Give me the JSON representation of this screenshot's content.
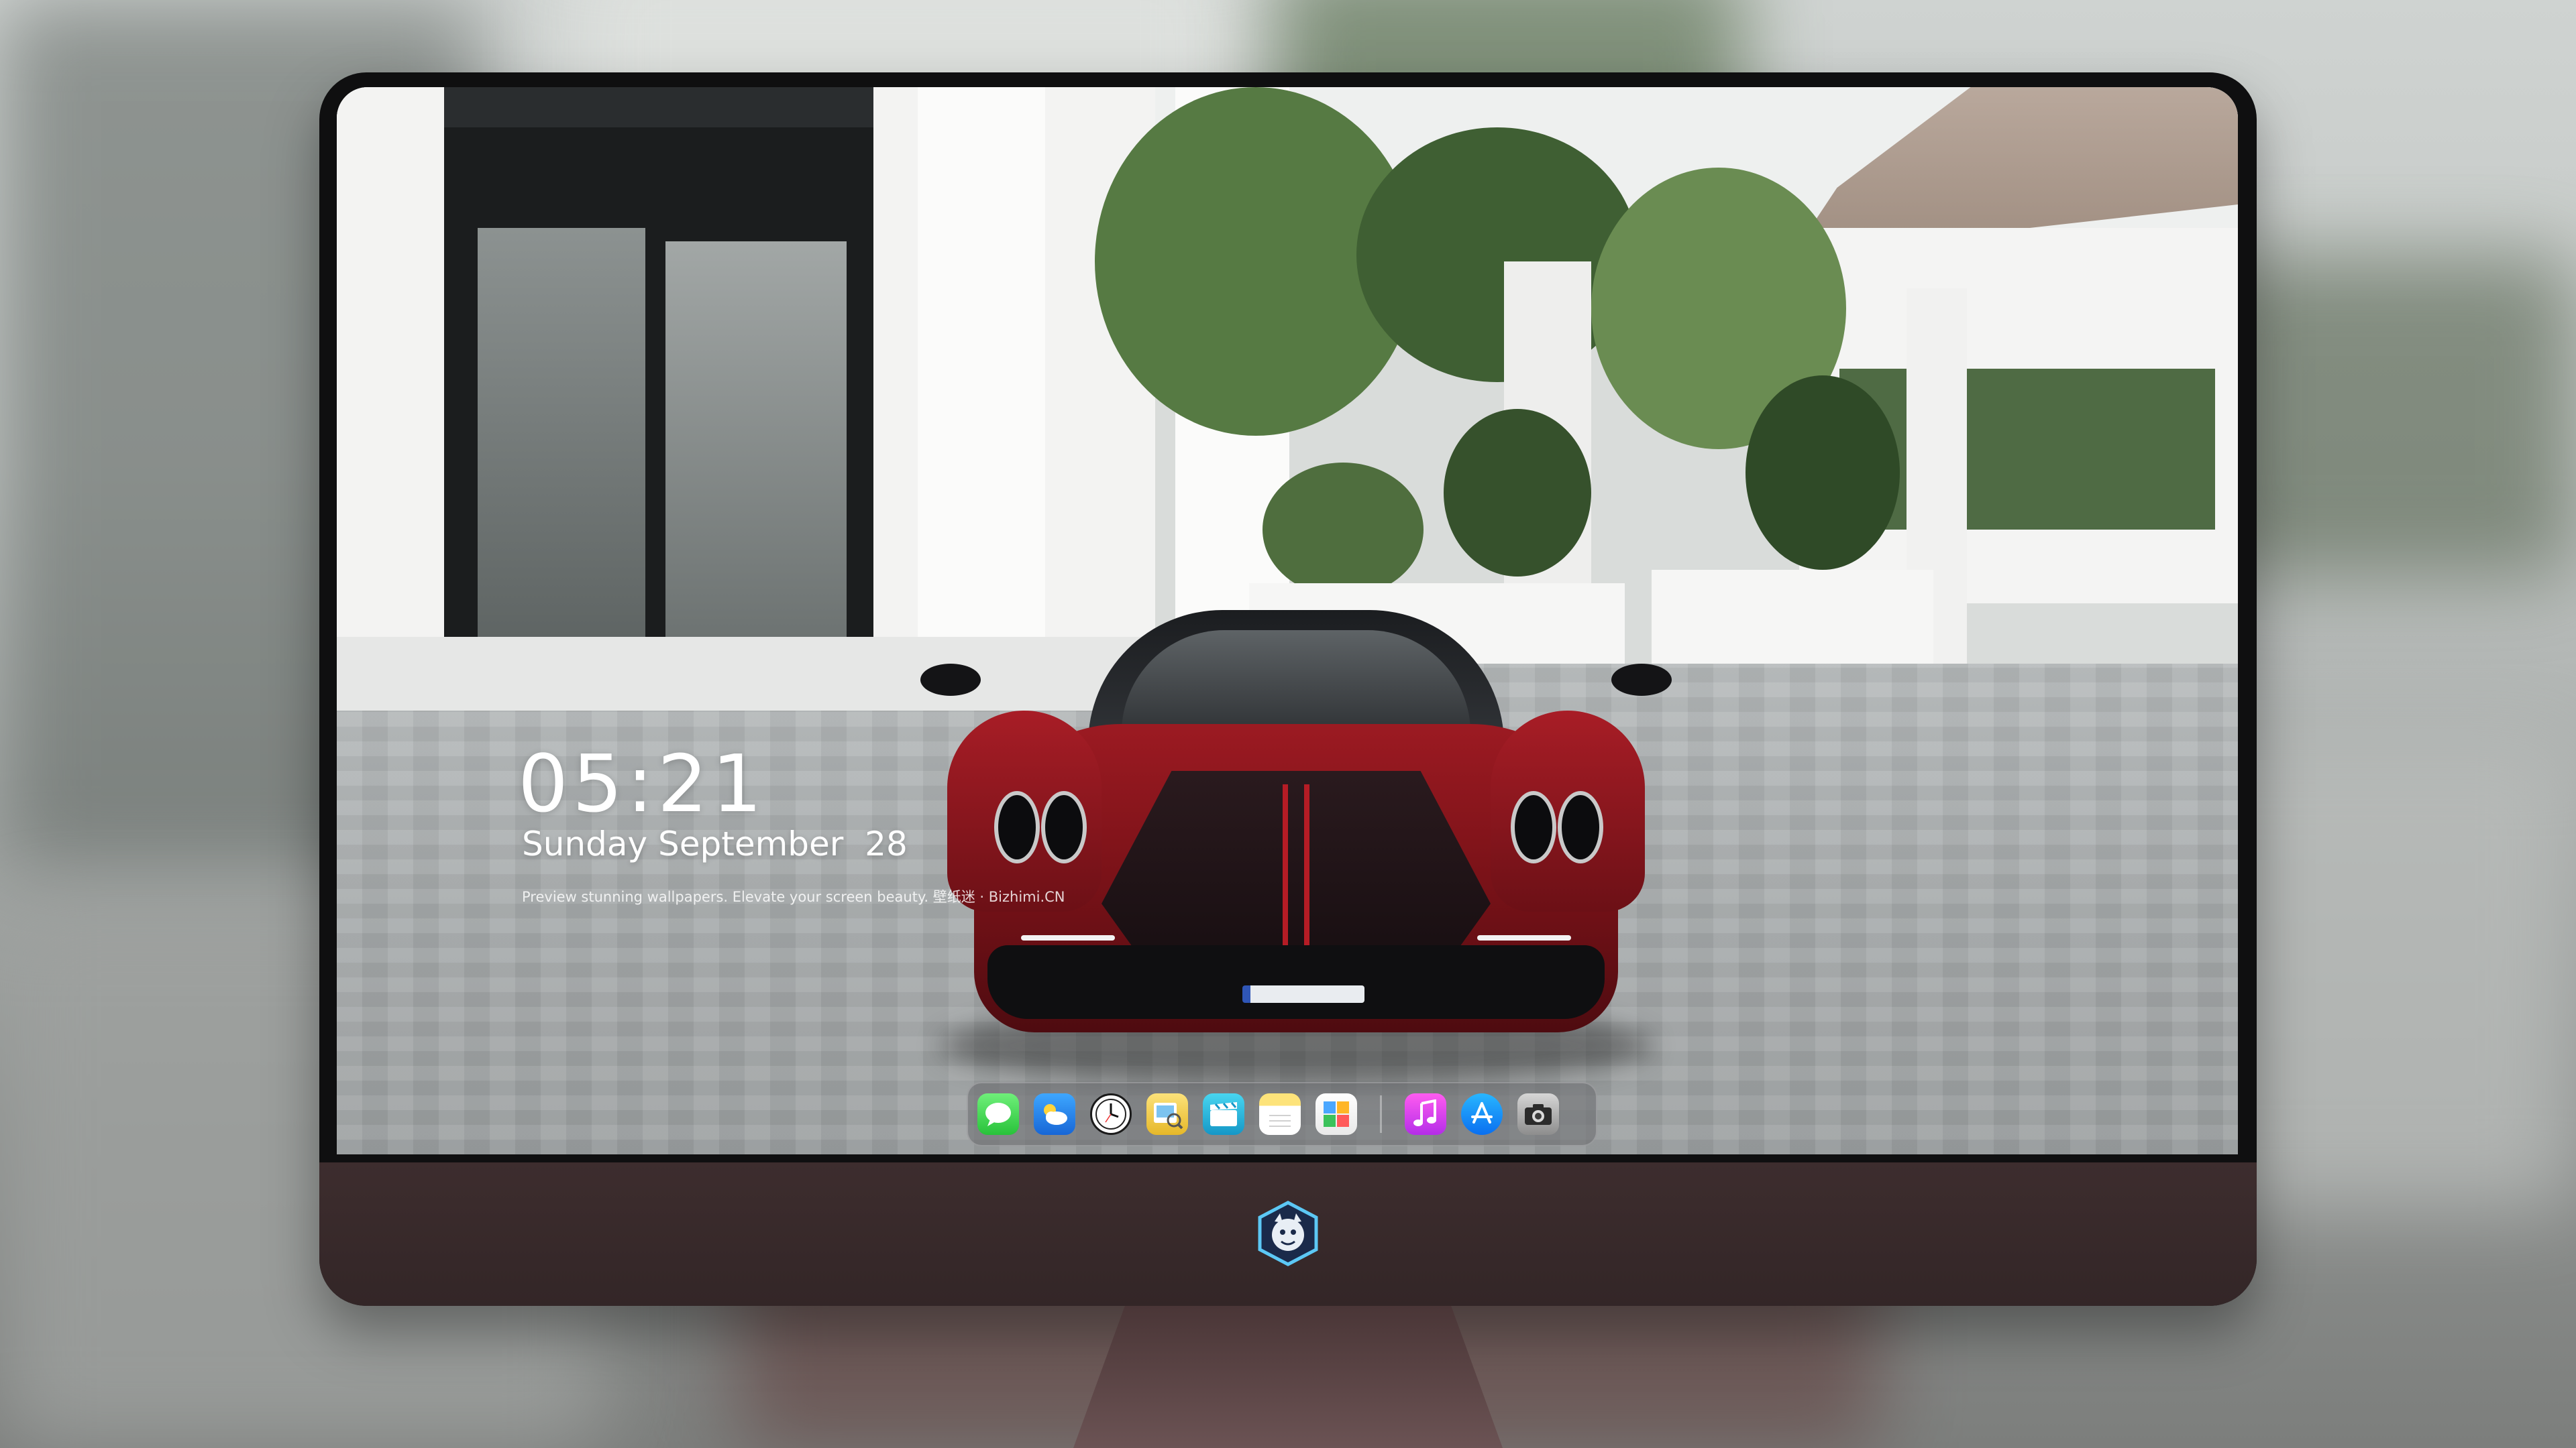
{
  "lock_screen": {
    "time": "05:21",
    "date": "Sunday September  28",
    "tagline": "Preview stunning wallpapers. Elevate your screen beauty. 壁纸迷 · Bizhimi.CN"
  },
  "dock": {
    "apps": [
      {
        "name": "Messages",
        "icon": "messages-icon"
      },
      {
        "name": "Weather",
        "icon": "weather-icon"
      },
      {
        "name": "Clock",
        "icon": "clock-icon"
      },
      {
        "name": "Preview",
        "icon": "preview-icon"
      },
      {
        "name": "Clips",
        "icon": "clips-icon"
      },
      {
        "name": "Notes",
        "icon": "notes-icon"
      },
      {
        "name": "Photos",
        "icon": "photos-icon"
      },
      {
        "name": "Music",
        "icon": "music-icon"
      },
      {
        "name": "App Store",
        "icon": "app-store-icon"
      },
      {
        "name": "Camera",
        "icon": "camera-icon"
      }
    ]
  },
  "monitor": {
    "logo": "dragon-mascot-logo"
  },
  "colors": {
    "chin": "#3d2d2e",
    "car_red": "#9c1a22",
    "dock_bg": "#6e7073"
  }
}
